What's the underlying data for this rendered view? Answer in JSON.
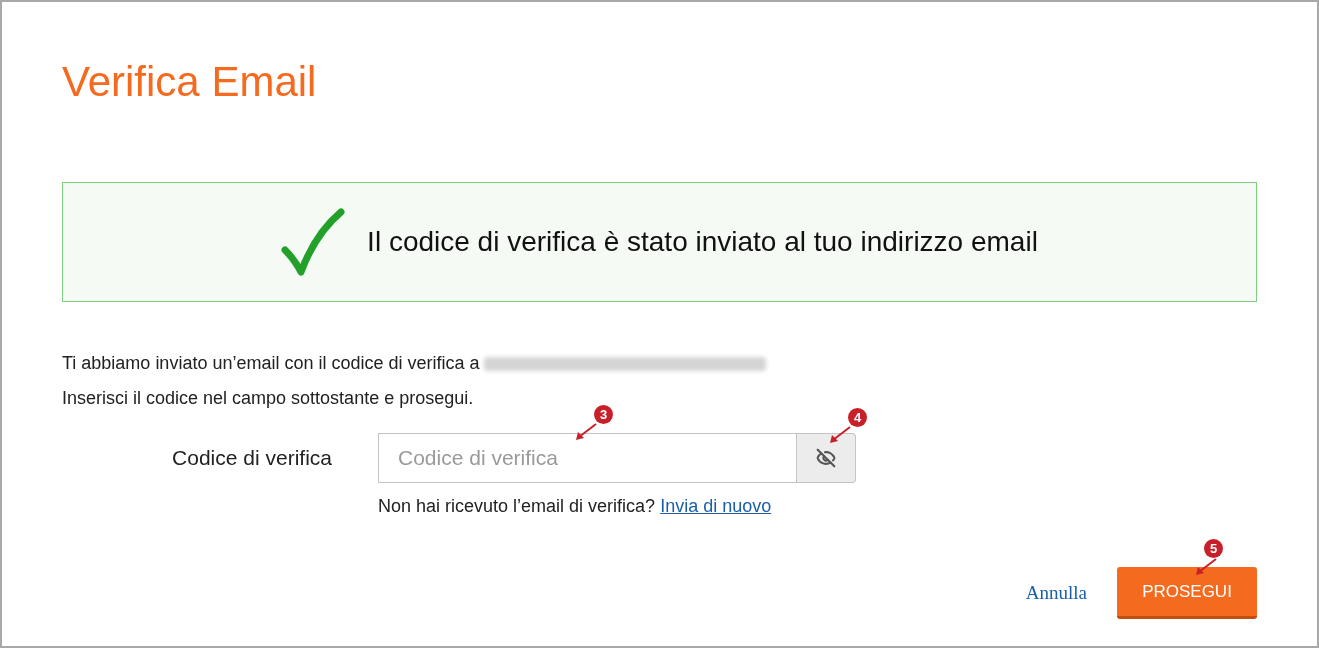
{
  "title": "Verifica Email",
  "alert": {
    "kind": "success",
    "message": "Il codice di verifica è stato inviato al tuo indirizzo email"
  },
  "intro": {
    "line_1": "Ti abbiamo inviato un’email con il codice di verifica a",
    "line_2": "Inserisci il codice nel campo sottostante e prosegui."
  },
  "code_field": {
    "label": "Codice di verifica",
    "placeholder": "Codice di verifica"
  },
  "resend": {
    "text": "Non hai ricevuto l’email di verifica?",
    "link": "Invia di nuovo"
  },
  "buttons": {
    "cancel": "Annulla",
    "submit": "PROSEGUI"
  },
  "annotations": [
    {
      "label": "3"
    },
    {
      "label": "4"
    },
    {
      "label": "5"
    }
  ]
}
